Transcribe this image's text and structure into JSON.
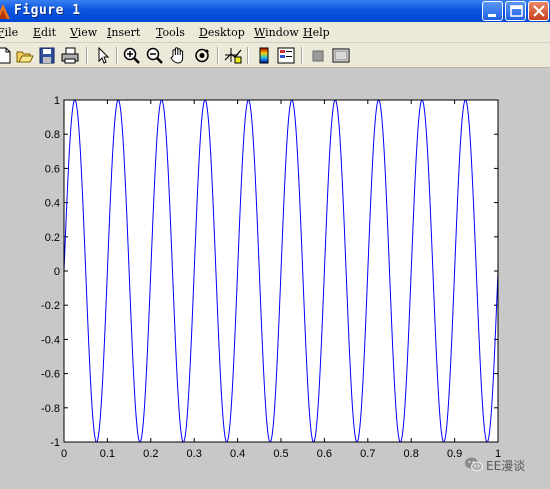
{
  "window": {
    "title": "Figure 1",
    "buttons": [
      "minimize-icon",
      "maximize-icon",
      "close-icon"
    ]
  },
  "menu": [
    {
      "mnemonic": "F",
      "rest": "ile"
    },
    {
      "mnemonic": "E",
      "rest": "dit"
    },
    {
      "mnemonic": "V",
      "rest": "iew"
    },
    {
      "mnemonic": "I",
      "rest": "nsert"
    },
    {
      "mnemonic": "T",
      "rest": "ools"
    },
    {
      "mnemonic": "D",
      "rest": "esktop"
    },
    {
      "mnemonic": "W",
      "rest": "indow"
    },
    {
      "mnemonic": "H",
      "rest": "elp"
    }
  ],
  "toolbar": {
    "icons": [
      "new-figure-icon",
      "open-file-icon",
      "save-icon",
      "print-icon",
      "edit-plot-arrow-icon",
      "zoom-in-icon",
      "zoom-out-icon",
      "pan-hand-icon",
      "rotate-3d-icon",
      "data-cursor-icon",
      "insert-colorbar-icon",
      "insert-legend-icon",
      "hide-plot-tools-icon",
      "show-plot-tools-icon"
    ]
  },
  "chart_data": {
    "type": "line",
    "title": "",
    "xlabel": "",
    "ylabel": "",
    "xlim": [
      0,
      1
    ],
    "ylim": [
      -1,
      1
    ],
    "xticks": [
      "0",
      "0.1",
      "0.2",
      "0.3",
      "0.4",
      "0.5",
      "0.6",
      "0.7",
      "0.8",
      "0.9",
      "1"
    ],
    "yticks": [
      "1",
      "0.8",
      "0.6",
      "0.4",
      "0.2",
      "0",
      "-0.2",
      "-0.4",
      "-0.6",
      "-0.8",
      "-1"
    ],
    "grid": false,
    "series": [
      {
        "function": "y = sin(2*pi*10*x)",
        "frequency_hz": 10,
        "amplitude": 1,
        "x_range": [
          0,
          1
        ],
        "color": "#0000ff"
      }
    ]
  },
  "watermark": {
    "text": "EE漫谈",
    "icon": "wechat-icon"
  }
}
